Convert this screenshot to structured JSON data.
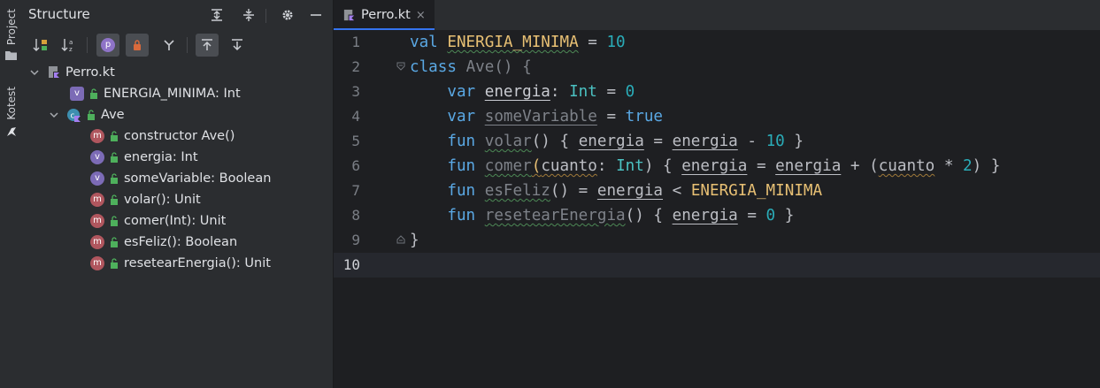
{
  "tool_strip": {
    "items": [
      {
        "label": "Project",
        "icon": "folder-icon"
      },
      {
        "label": "Kotest",
        "icon": "kotest-icon"
      }
    ]
  },
  "structure_panel": {
    "title": "Structure",
    "tree": {
      "root": {
        "label": "Perro.kt",
        "icon": "kotlin-file-icon",
        "expanded": true
      },
      "items": [
        {
          "label": "ENERGIA_MINIMA: Int",
          "kind": "v",
          "depth": 1
        },
        {
          "label": "Ave",
          "kind": "class",
          "depth": 1,
          "expanded": true
        },
        {
          "label": "constructor Ave()",
          "kind": "m",
          "depth": 2
        },
        {
          "label": "energia: Int",
          "kind": "v",
          "depth": 2
        },
        {
          "label": "someVariable: Boolean",
          "kind": "v",
          "depth": 2
        },
        {
          "label": "volar(): Unit",
          "kind": "m",
          "depth": 2
        },
        {
          "label": "comer(Int): Unit",
          "kind": "m",
          "depth": 2
        },
        {
          "label": "esFeliz(): Boolean",
          "kind": "m",
          "depth": 2
        },
        {
          "label": "resetearEnergia(): Unit",
          "kind": "m",
          "depth": 2
        }
      ]
    }
  },
  "editor": {
    "tab": {
      "label": "Perro.kt",
      "close": "×"
    },
    "line_numbers": [
      "1",
      "2",
      "3",
      "4",
      "5",
      "6",
      "7",
      "8",
      "9",
      "10"
    ],
    "current_line": "10",
    "code": {
      "l1": {
        "kw": "val",
        "name": "ENERGIA_MINIMA",
        "eq": " = ",
        "num": "10"
      },
      "l2": {
        "kw": "class",
        "name": "Ave",
        "rest": "() {"
      },
      "l3": {
        "kw": "var",
        "name": "energia",
        "colon": ": ",
        "type": "Int",
        "eq": " = ",
        "num": "0"
      },
      "l4": {
        "kw": "var",
        "name": "someVariable",
        "eq": " = ",
        "val": "true"
      },
      "l5": {
        "kw": "fun",
        "name": "volar",
        "p1": "() { ",
        "a": "energia",
        "eq": " = ",
        "b": "energia",
        "op": " - ",
        "num": "10",
        "end": " }"
      },
      "l6": {
        "kw": "fun",
        "name": "comer",
        "p1": "(",
        "param": "cuanto",
        "colon": ": ",
        "type": "Int",
        "p2": ") { ",
        "a": "energia",
        "eq": " = ",
        "b": "energia",
        "op": " + (",
        "c": "cuanto",
        "op2": " * ",
        "num": "2",
        "end": ") }"
      },
      "l7": {
        "kw": "fun",
        "name": "esFeliz",
        "p1": "() = ",
        "a": "energia",
        "op": " < ",
        "const": "ENERGIA_MINIMA"
      },
      "l8": {
        "kw": "fun",
        "name": "resetearEnergia",
        "p1": "() { ",
        "a": "energia",
        "eq": " = ",
        "num": "0",
        "end": " }"
      },
      "l9": {
        "brace": "}"
      },
      "l10": {
        "text": ""
      }
    }
  }
}
